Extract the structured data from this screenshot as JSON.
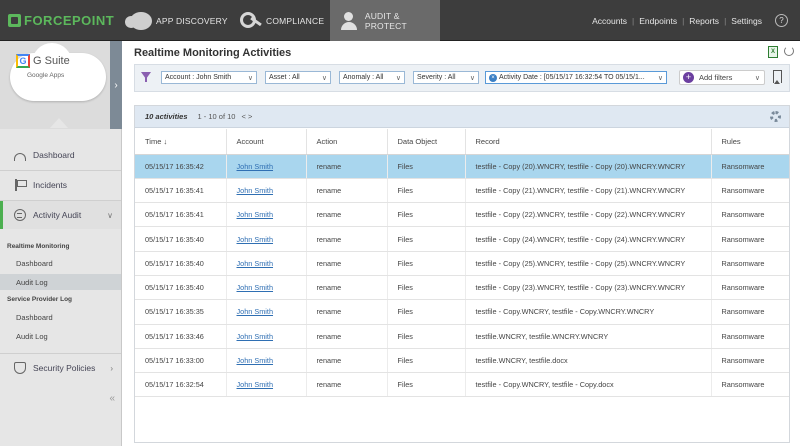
{
  "brand": {
    "name": "FORCEPOINT",
    "color": "#5cb85c"
  },
  "nav": {
    "tabs": [
      {
        "label": "APP DISCOVERY",
        "icon": "cloud-icon"
      },
      {
        "label": "COMPLIANCE",
        "icon": "key-icon"
      },
      {
        "label": "AUDIT & PROTECT",
        "icon": "person-shield-icon",
        "active": true
      }
    ],
    "links": [
      "Accounts",
      "Endpoints",
      "Reports",
      "Settings"
    ],
    "help": "?"
  },
  "app": {
    "name": "G Suite",
    "g": "G",
    "subtitle": "Google Apps"
  },
  "sidebar": {
    "dashboard": "Dashboard",
    "incidents": "Incidents",
    "activity_audit": "Activity Audit",
    "groups": [
      {
        "title": "Realtime Monitoring",
        "items": [
          "Dashboard",
          "Audit Log"
        ]
      },
      {
        "title": "Service Provider Log",
        "items": [
          "Dashboard",
          "Audit Log"
        ]
      }
    ],
    "security_policies": "Security Policies",
    "collapse": "«"
  },
  "page": {
    "title": "Realtime Monitoring Activities"
  },
  "filters": {
    "account": "Account : John Smith",
    "asset": "Asset : All",
    "anomaly": "Anomaly : All",
    "severity": "Severity : All",
    "activity_date": "Activity Date : [05/15/17 16:32:54 TO 05/15/1...",
    "add_filters": "Add filters",
    "plus": "+"
  },
  "table": {
    "count_label": "10 activities",
    "pager": "1 - 10 of 10",
    "pager_arrows": "< >",
    "columns": [
      "Time ↓",
      "Account",
      "Action",
      "Data Object",
      "Record",
      "Rules"
    ],
    "rows": [
      [
        "05/15/17 16:35:42",
        "John Smith",
        "rename",
        "Files",
        "testfile - Copy (20).WNCRY, testfile - Copy (20).WNCRY.WNCRY",
        "Ransomware"
      ],
      [
        "05/15/17 16:35:41",
        "John Smith",
        "rename",
        "Files",
        "testfile - Copy (21).WNCRY, testfile - Copy (21).WNCRY.WNCRY",
        "Ransomware"
      ],
      [
        "05/15/17 16:35:41",
        "John Smith",
        "rename",
        "Files",
        "testfile - Copy (22).WNCRY, testfile - Copy (22).WNCRY.WNCRY",
        "Ransomware"
      ],
      [
        "05/15/17 16:35:40",
        "John Smith",
        "rename",
        "Files",
        "testfile - Copy (24).WNCRY, testfile - Copy (24).WNCRY.WNCRY",
        "Ransomware"
      ],
      [
        "05/15/17 16:35:40",
        "John Smith",
        "rename",
        "Files",
        "testfile - Copy (25).WNCRY, testfile - Copy (25).WNCRY.WNCRY",
        "Ransomware"
      ],
      [
        "05/15/17 16:35:40",
        "John Smith",
        "rename",
        "Files",
        "testfile - Copy (23).WNCRY, testfile - Copy (23).WNCRY.WNCRY",
        "Ransomware"
      ],
      [
        "05/15/17 16:35:35",
        "John Smith",
        "rename",
        "Files",
        "testfile - Copy.WNCRY, testfile - Copy.WNCRY.WNCRY",
        "Ransomware"
      ],
      [
        "05/15/17 16:33:46",
        "John Smith",
        "rename",
        "Files",
        "testfile.WNCRY, testfile.WNCRY.WNCRY",
        "Ransomware"
      ],
      [
        "05/15/17 16:33:00",
        "John Smith",
        "rename",
        "Files",
        "testfile.WNCRY, testfile.docx",
        "Ransomware"
      ],
      [
        "05/15/17 16:32:54",
        "John Smith",
        "rename",
        "Files",
        "testfile - Copy.WNCRY, testfile - Copy.docx",
        "Ransomware"
      ]
    ],
    "selected_row": 0
  }
}
